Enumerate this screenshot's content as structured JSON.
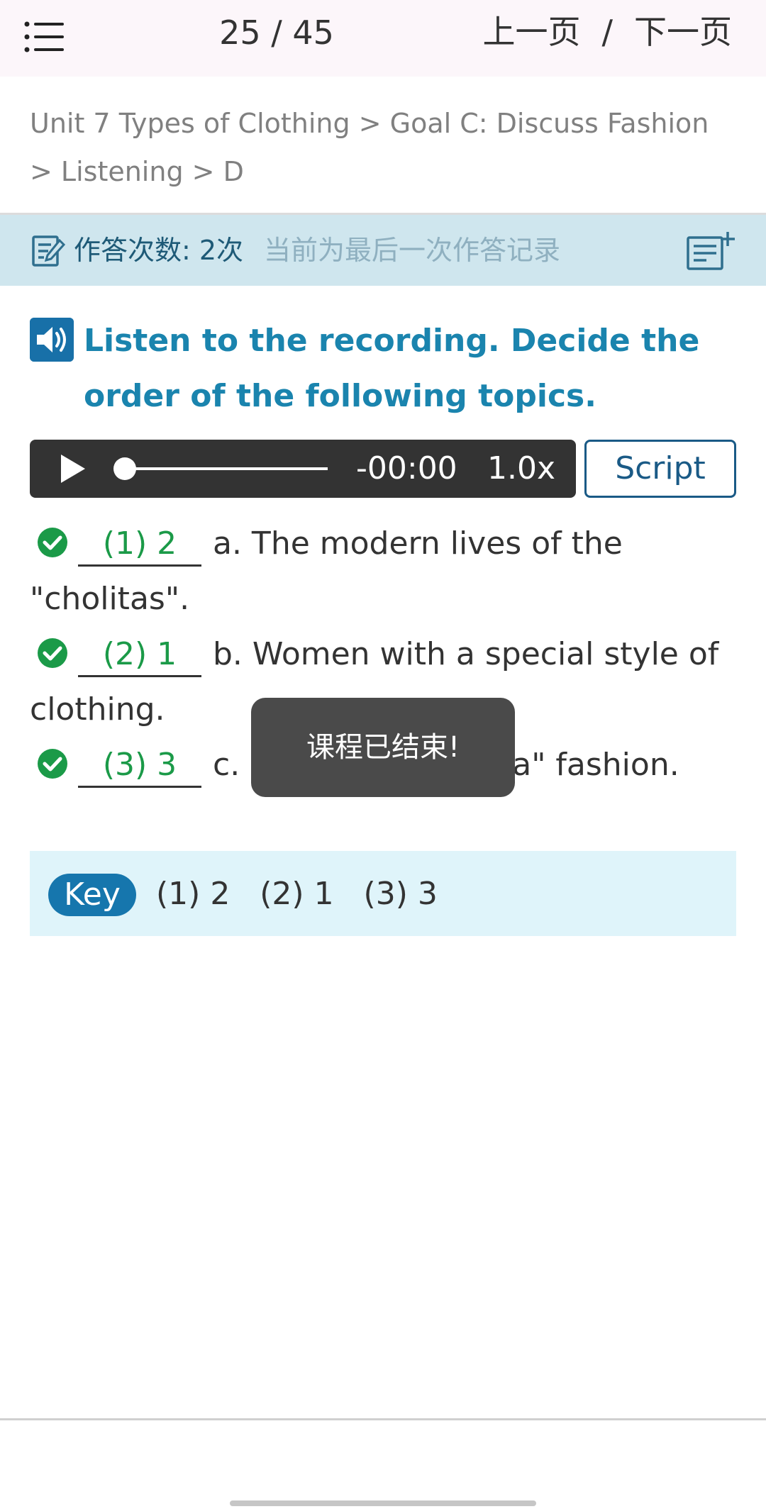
{
  "header": {
    "page_counter": "25 / 45",
    "prev_label": "上一页",
    "separator": "/",
    "next_label": "下一页"
  },
  "breadcrumb": "Unit 7 Types of Clothing > Goal C: Discuss Fashion > Listening > D",
  "answer_record": {
    "attempts": "作答次数: 2次",
    "note": "当前为最后一次作答记录"
  },
  "instruction": "Listen to the recording. Decide the order of the following topics.",
  "player": {
    "time": "-00:00",
    "speed": "1.0x",
    "progress": 0
  },
  "script_label": "Script",
  "questions": [
    {
      "answer": "(1) 2",
      "text_line1": "a. The modern lives of the",
      "text_line2": "\"cholitas\"."
    },
    {
      "answer": "(2) 1",
      "text_line1": "b. Women with a special style of",
      "text_line2": "clothing."
    },
    {
      "answer": "(3) 3",
      "text_line1": "c.",
      "text_tail": "la\" fashion."
    }
  ],
  "toast": "课程已结束!",
  "key": {
    "label": "Key",
    "answers": "(1) 2   (2) 1   (3) 3"
  },
  "colors": {
    "accent": "#1a84ae",
    "correct": "#1b9a48",
    "player_bg": "#333333"
  }
}
